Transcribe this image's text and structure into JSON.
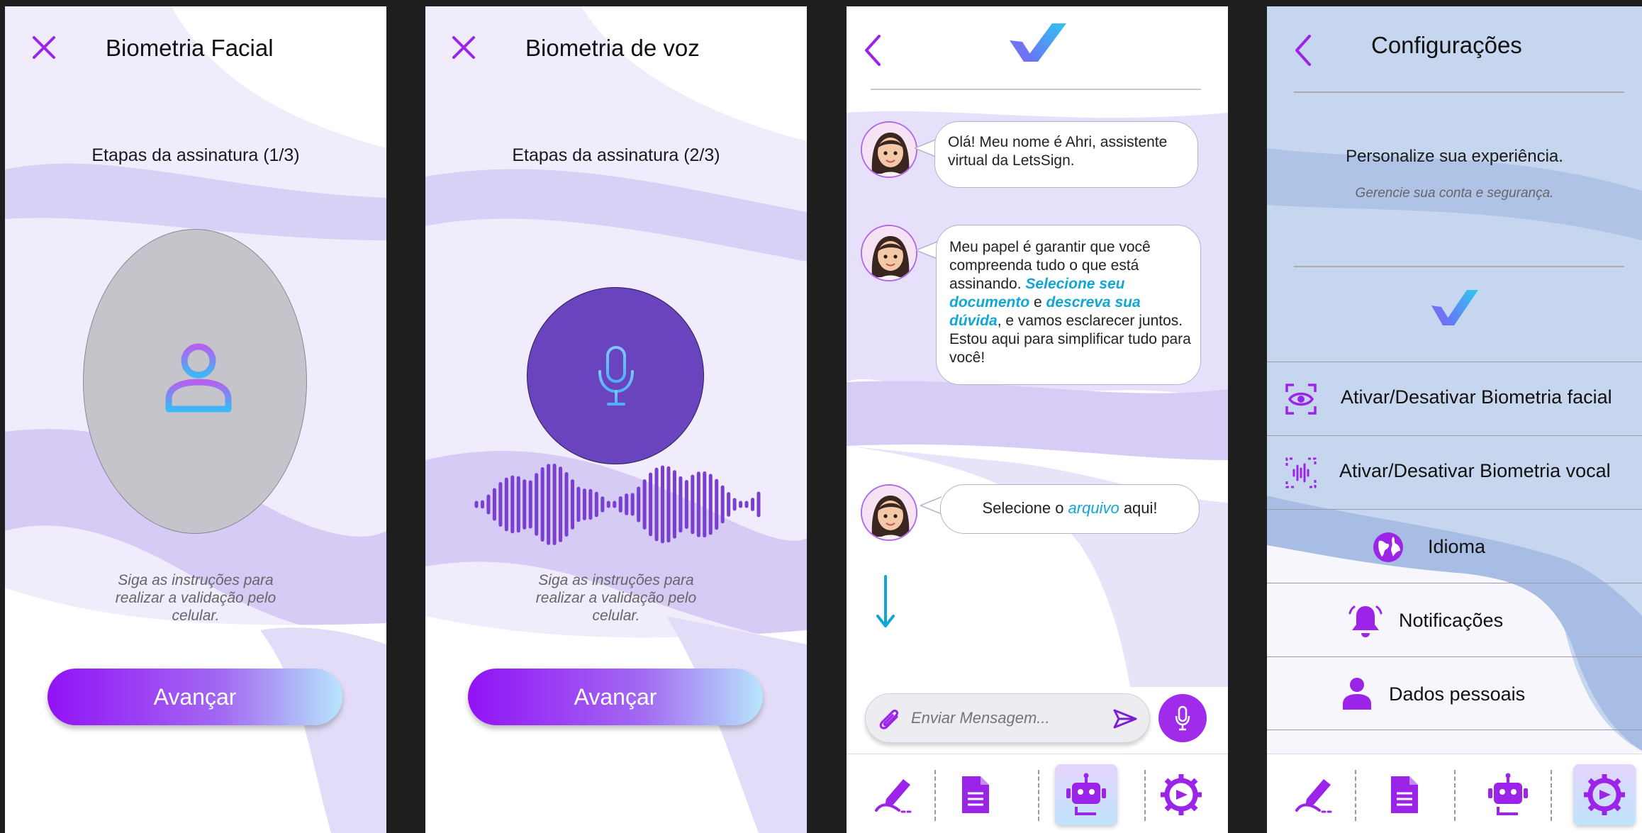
{
  "colors": {
    "purple": "#9b24e8",
    "accent_blue": "#11a6d4",
    "mic_circle": "#6a44bf"
  },
  "facial": {
    "title": "Biometria Facial",
    "step": "Etapas da assinatura (1/3)",
    "hint": "Siga as instruções para realizar a validação pelo celular.",
    "button": "Avançar",
    "icons": {
      "close": "close-icon",
      "user": "user-icon"
    }
  },
  "voice": {
    "title": "Biometria de voz",
    "step": "Etapas da assinatura (2/3)",
    "hint": "Siga as instruções para realizar a validação pelo celular.",
    "button": "Avançar",
    "icons": {
      "close": "close-icon",
      "mic": "microphone-icon",
      "wave": "waveform-icon"
    }
  },
  "chat": {
    "messages": [
      {
        "text": "Olá! Meu nome é Ahri, assistente virtual da LetsSign."
      },
      {
        "parts": [
          "Meu papel é garantir que você compreenda tudo o que está assinando. ",
          "Selecione seu documento",
          " e ",
          "descreva sua dúvida",
          ", e vamos esclarecer juntos. Estou aqui para simplificar tudo para você!"
        ]
      },
      {
        "parts": [
          "Selecione o ",
          "arquivo",
          " aqui!"
        ]
      }
    ],
    "input_placeholder": "Enviar Mensagem...",
    "icons": {
      "back": "chevron-left-icon",
      "logo": "letssign-logo-icon",
      "arrow": "arrow-down-icon",
      "attach": "paperclip-icon",
      "send": "send-icon",
      "mic": "microphone-icon"
    }
  },
  "settings": {
    "title": "Configurações",
    "subtitle": "Personalize sua experiência.",
    "caption": "Gerencie sua conta e segurança.",
    "menu": [
      {
        "label": "Ativar/Desativar Biometria facial",
        "icon": "eye-scan-icon"
      },
      {
        "label": "Ativar/Desativar Biometria vocal",
        "icon": "voice-scan-icon"
      },
      {
        "label": "Idioma",
        "icon": "globe-icon"
      },
      {
        "label": "Notificações",
        "icon": "bell-icon"
      },
      {
        "label": "Dados pessoais",
        "icon": "person-icon"
      }
    ]
  },
  "nav": {
    "items": [
      {
        "icon": "signature-icon"
      },
      {
        "icon": "document-icon"
      },
      {
        "icon": "robot-icon"
      },
      {
        "icon": "settings-gear-icon"
      }
    ],
    "chat_active": 2,
    "settings_active": 3
  }
}
